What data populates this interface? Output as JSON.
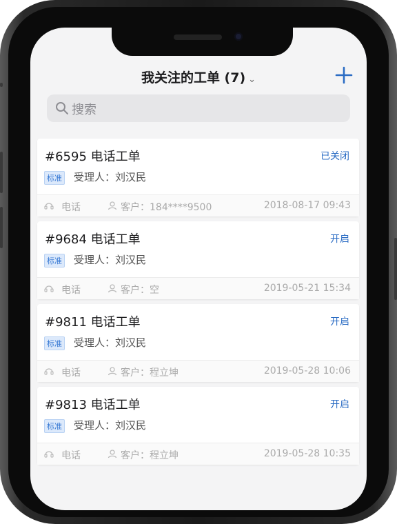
{
  "header": {
    "title": "我关注的工单 (7)",
    "add_icon": "plus-icon"
  },
  "search": {
    "placeholder": "搜索",
    "icon": "search-icon"
  },
  "tickets": [
    {
      "title": "#6595 电话工单",
      "status": "已关闭",
      "tag": "标准",
      "assignee": "受理人：刘汉民",
      "channel": "电话",
      "customer": "客户：184****9500",
      "time": "2018-08-17 09:43"
    },
    {
      "title": "#9684 电话工单",
      "status": "开启",
      "tag": "标准",
      "assignee": "受理人：刘汉民",
      "channel": "电话",
      "customer": "客户：空",
      "time": "2019-05-21 15:34"
    },
    {
      "title": "#9811 电话工单",
      "status": "开启",
      "tag": "标准",
      "assignee": "受理人：刘汉民",
      "channel": "电话",
      "customer": "客户：程立坤",
      "time": "2019-05-28 10:06"
    },
    {
      "title": "#9813 电话工单",
      "status": "开启",
      "tag": "标准",
      "assignee": "受理人：刘汉民",
      "channel": "电话",
      "customer": "客户：程立坤",
      "time": "2019-05-28 10:35"
    }
  ],
  "colors": {
    "accent": "#2b6cc4",
    "tag_bg": "#dce9fb",
    "background": "#f4f4f5"
  }
}
